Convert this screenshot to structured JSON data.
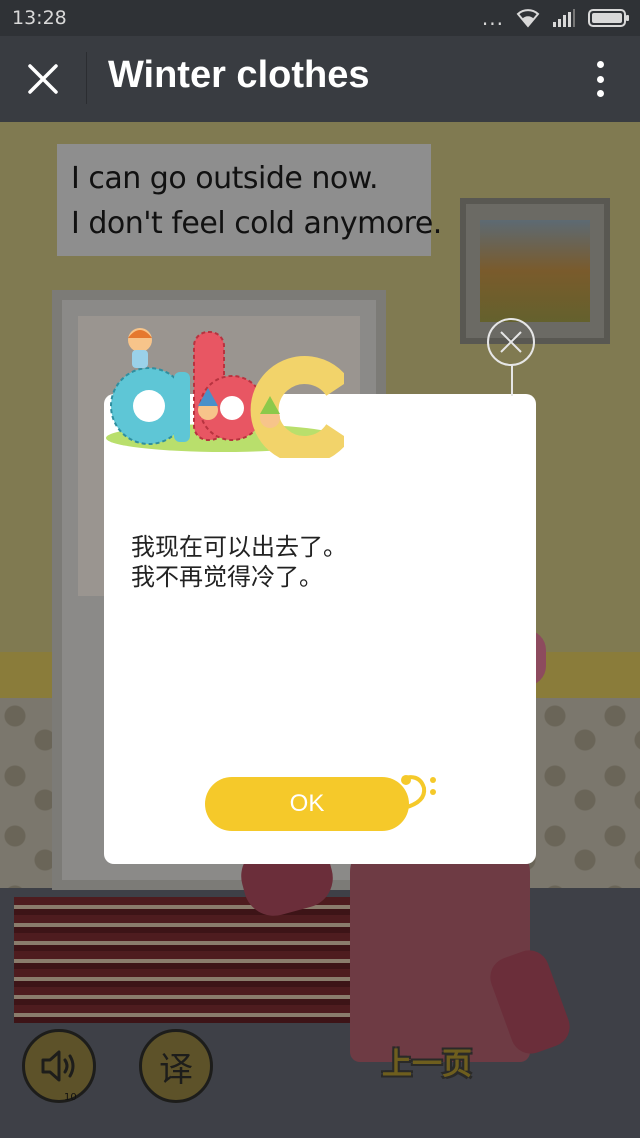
{
  "status_bar": {
    "time": "13:28",
    "dots": "...",
    "icons": [
      "wifi-icon",
      "signal-icon",
      "battery-icon"
    ]
  },
  "app_bar": {
    "title": "Winter clothes",
    "close_icon": "close-icon",
    "more_icon": "more-vertical-icon"
  },
  "story": {
    "caption_lines": [
      "I can go outside now.",
      "I don't feel cold anymore."
    ],
    "translate_label": "译",
    "prev_page_label": "上一页",
    "page_number": "10"
  },
  "dialog": {
    "translation_lines": [
      "我现在可以出去了。",
      "我不再觉得冷了。"
    ],
    "ok_label": "OK",
    "logo_letters": "abc"
  },
  "colors": {
    "ok_button": "#f5c92a",
    "dialog_bg": "#ffffff",
    "app_bar": "#393c41"
  }
}
